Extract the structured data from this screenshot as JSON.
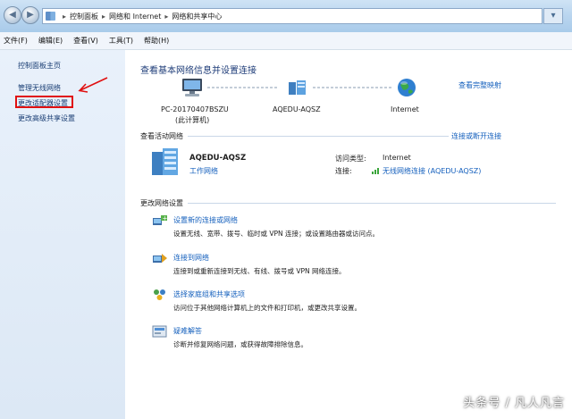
{
  "address_bar": {
    "crumbs": [
      "控制面板",
      "网络和 Internet",
      "网络和共享中心"
    ]
  },
  "menu": {
    "items": [
      "文件(F)",
      "编辑(E)",
      "查看(V)",
      "工具(T)",
      "帮助(H)"
    ]
  },
  "sidebar": {
    "items": [
      {
        "label": "控制面板主页"
      },
      {
        "label": "管理无线网络"
      },
      {
        "label": "更改适配器设置"
      },
      {
        "label": "更改高级共享设置"
      }
    ]
  },
  "main": {
    "title": "查看基本网络信息并设置连接",
    "full_map_link": "查看完整映射",
    "network_map": {
      "computer_name": "PC-20170407BSZU",
      "computer_sub": "(此计算机)",
      "network_name": "AQEDU-AQSZ",
      "internet_label": "Internet"
    },
    "active_networks": {
      "heading": "查看活动网络",
      "connect_link": "连接或断开连接",
      "network_name": "AQEDU-AQSZ",
      "network_type": "工作网络",
      "access_type_label": "访问类型:",
      "access_type_value": "Internet",
      "connection_label": "连接:",
      "connection_value": "无线网络连接 (AQEDU-AQSZ)"
    },
    "change_settings": {
      "heading": "更改网络设置",
      "tasks": [
        {
          "title": "设置新的连接或网络",
          "desc": "设置无线、宽带、拨号、临时或 VPN 连接；或设置路由器或访问点。"
        },
        {
          "title": "连接到网络",
          "desc": "连接到或重新连接到无线、有线、拨号或 VPN 网络连接。"
        },
        {
          "title": "选择家庭组和共享选项",
          "desc": "访问位于其他网络计算机上的文件和打印机，或更改共享设置。"
        },
        {
          "title": "疑难解答",
          "desc": "诊断并修复网络问题，或获得故障排除信息。"
        }
      ]
    }
  },
  "watermark": "头条号 / 凡人凡言",
  "colors": {
    "link": "#1560bd",
    "heading": "#1e3c78",
    "highlight": "#e01010"
  }
}
